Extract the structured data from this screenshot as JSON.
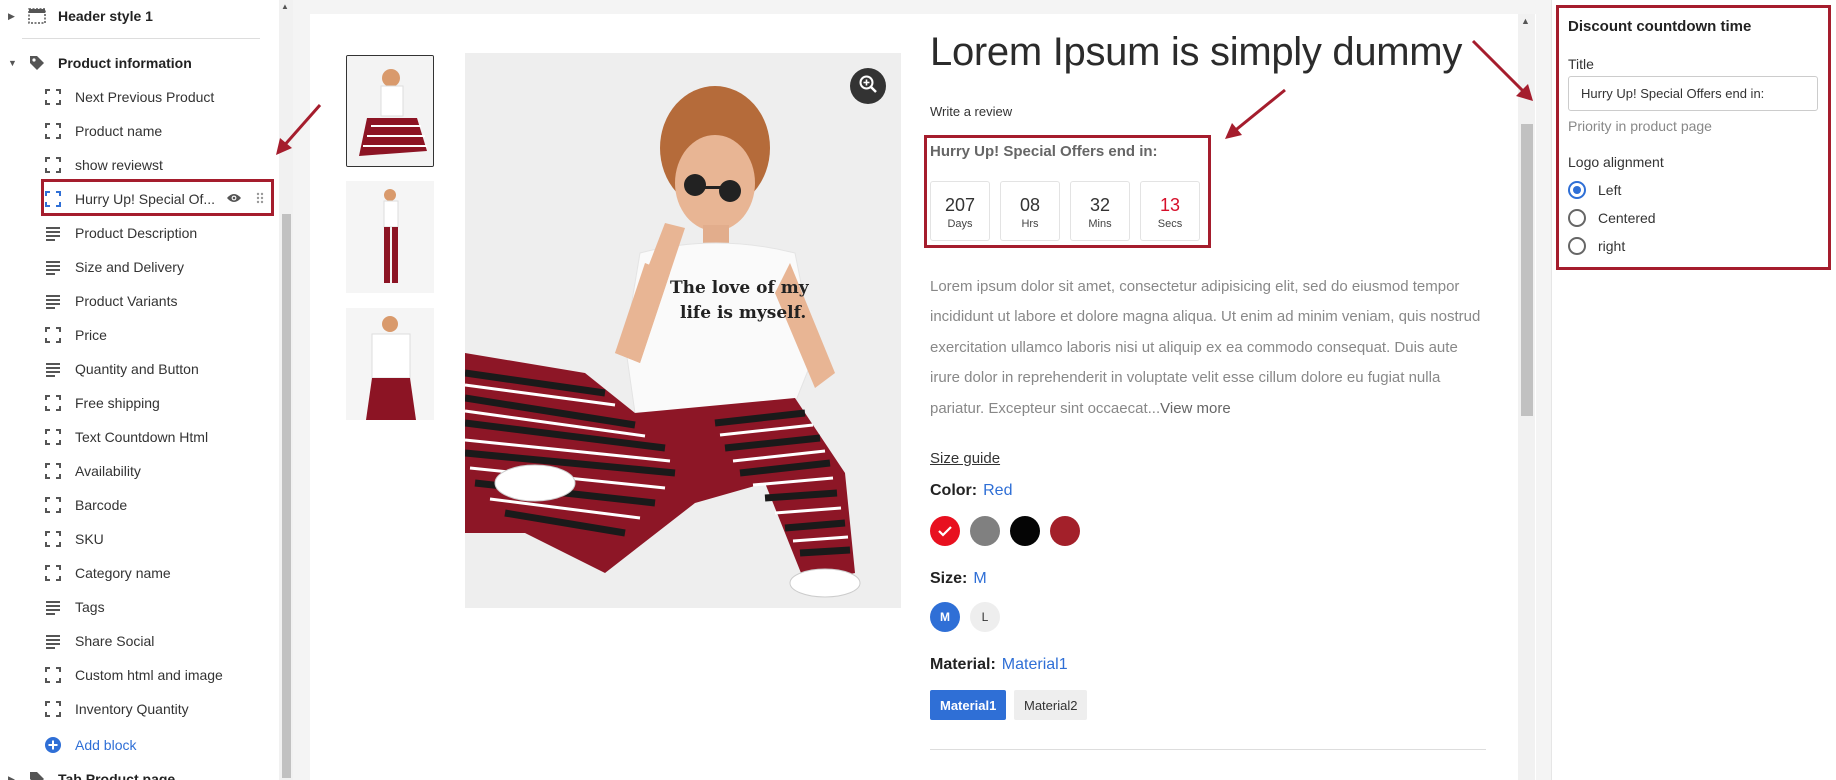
{
  "sidebar": {
    "header_group": {
      "label": "Header style 1"
    },
    "product_group": {
      "label": "Product information"
    },
    "items": [
      {
        "label": "Next Previous Product",
        "icon": "section-frame-icon"
      },
      {
        "label": "Product name",
        "icon": "section-frame-icon"
      },
      {
        "label": "show reviewst",
        "icon": "section-frame-icon"
      },
      {
        "label": "Hurry Up! Special Of...",
        "icon": "section-frame-icon",
        "selected": true
      },
      {
        "label": "Product Description",
        "icon": "text-lines-icon"
      },
      {
        "label": "Size and Delivery",
        "icon": "text-lines-icon"
      },
      {
        "label": "Product Variants",
        "icon": "text-lines-icon"
      },
      {
        "label": "Price",
        "icon": "section-frame-icon"
      },
      {
        "label": "Quantity and Button",
        "icon": "text-lines-icon"
      },
      {
        "label": "Free shipping",
        "icon": "section-frame-icon"
      },
      {
        "label": "Text Countdown Html",
        "icon": "section-frame-icon"
      },
      {
        "label": "Availability",
        "icon": "section-frame-icon"
      },
      {
        "label": "Barcode",
        "icon": "section-frame-icon"
      },
      {
        "label": "SKU",
        "icon": "section-frame-icon"
      },
      {
        "label": "Category name",
        "icon": "section-frame-icon"
      },
      {
        "label": "Tags",
        "icon": "text-lines-icon"
      },
      {
        "label": "Share Social",
        "icon": "text-lines-icon"
      },
      {
        "label": "Custom html and image",
        "icon": "section-frame-icon"
      },
      {
        "label": "Inventory Quantity",
        "icon": "section-frame-icon"
      }
    ],
    "add_block": "Add block",
    "tab_group": {
      "label": "Tab Product page"
    }
  },
  "product": {
    "title": "Lorem Ipsum is simply dummy",
    "review_link": "Write a review",
    "countdown": {
      "title": "Hurry Up! Special Offers end in:",
      "units": [
        {
          "value": "207",
          "label": "Days"
        },
        {
          "value": "08",
          "label": "Hrs"
        },
        {
          "value": "32",
          "label": "Mins"
        },
        {
          "value": "13",
          "label": "Secs"
        }
      ]
    },
    "description": "Lorem ipsum dolor sit amet, consectetur adipisicing elit, sed do eiusmod tempor incididunt ut labore et dolore magna aliqua. Ut enim ad minim veniam, quis nostrud exercitation ullamco laboris nisi ut aliquip ex ea commodo consequat. Duis aute irure dolor in reprehenderit in voluptate velit esse cillum dolore eu fugiat nulla pariatur. Excepteur sint occaecat...",
    "view_more": "View more",
    "size_guide": "Size guide",
    "color": {
      "label": "Color:",
      "value": "Red",
      "swatches": [
        "#e8101f",
        "#808080",
        "#050505",
        "#a3202a"
      ]
    },
    "size": {
      "label": "Size:",
      "value": "M",
      "options": [
        "M",
        "L"
      ]
    },
    "material": {
      "label": "Material:",
      "value": "Material1",
      "options": [
        "Material1",
        "Material2"
      ]
    },
    "tshirt_text": "The love of my life is myself."
  },
  "settings": {
    "panel_title": "Discount countdown time",
    "title_label": "Title",
    "title_value": "Hurry Up! Special Offers end in:",
    "help_text": "Priority in product page",
    "alignment_label": "Logo alignment",
    "alignment_options": [
      "Left",
      "Centered",
      "right"
    ],
    "alignment_selected": "Left"
  },
  "colors": {
    "accent": "#2f6fd6",
    "highlight": "#a51d2d",
    "countdown_secs": "#d60f2a"
  }
}
